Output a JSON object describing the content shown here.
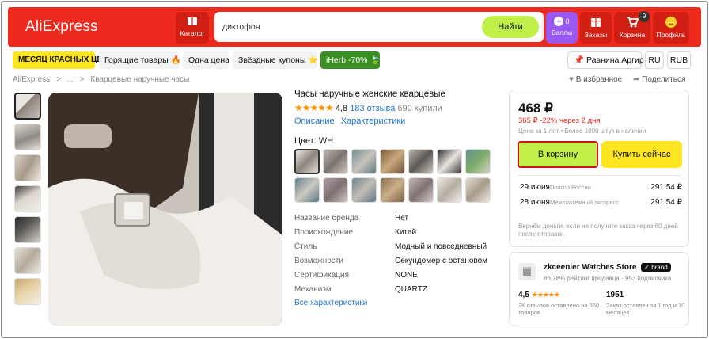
{
  "header": {
    "logo": "AliExpress",
    "catalog_label": "Каталог",
    "search_value": "диктофон",
    "search_button": "Найти",
    "points_label": "Баллы",
    "points_value": "0",
    "orders_label": "Заказы",
    "cart_label": "Корзина",
    "cart_count": "9",
    "profile_label": "Профиль"
  },
  "promo": {
    "red_prices": "МЕСЯЦ КРАСНЫХ ЦЕН",
    "hot": "Горящие товары 🔥",
    "one_price": "Одна цена",
    "star_coupons": "Звёздные купоны ⭐",
    "iherb": "iHerb -70%",
    "location": "Равнина Аргир",
    "lang": "RU",
    "currency": "RUB"
  },
  "breadcrumb": {
    "root": "AliExpress",
    "sep": ">",
    "ellipsis": "...",
    "current": "Кварцевые наручные часы",
    "favorite": "В избранное",
    "share": "Поделиться"
  },
  "product": {
    "title": "Часы наручные женские кварцевые",
    "stars": "★★★★★",
    "rating": "4,8",
    "reviews": "183 отзыва",
    "sold": "690 купили",
    "tab_description": "Описание",
    "tab_specs": "Характеристики",
    "color_label": "Цвет: WH",
    "specs": [
      {
        "k": "Название бренда",
        "v": "Нет"
      },
      {
        "k": "Происхождение",
        "v": "Китай"
      },
      {
        "k": "Стиль",
        "v": "Модный и повседневный"
      },
      {
        "k": "Возможности",
        "v": "Секундомер с остановом"
      },
      {
        "k": "Сертификация",
        "v": "NONE"
      },
      {
        "k": "Механизм",
        "v": "QUARTZ"
      }
    ],
    "all_specs": "Все характеристики"
  },
  "buybox": {
    "price": "468 ₽",
    "old_price": "365 ₽",
    "discount": "-22%",
    "discount_period": "через 2 дня",
    "unit_note": "Цена за 1 лот • Более 1000 штук в наличии",
    "cart_button": "В корзину",
    "buy_button": "Купить сейчас",
    "shipping": [
      {
        "date": "29 июня",
        "service": "Почтой России",
        "price": "291,54 ₽"
      },
      {
        "date": "28 июня",
        "service": "Межплатежный экспресс",
        "price": "291,54 ₽"
      }
    ],
    "refund_note": "Вернём деньги, если не получите заказ через 60 дней после отправки."
  },
  "store": {
    "name": "zkceenier Watches Store",
    "brand_tag": "brand",
    "sub": "86,78% рейтинг продавца · 953 подписчика",
    "rating": "4,5",
    "rating_stars": "★★★★★",
    "rating_sub": "2К отзывов оставлено на 560 товаров",
    "orders": "1951",
    "orders_sub": "Заказ оставлен за 1 год и 10 месяцев"
  },
  "colors": {
    "header_red": "#ed2a1d",
    "accent_green": "#c0f048",
    "accent_yellow": "#ffe620",
    "points_purple": "#9a58f3",
    "link_blue": "#2277cc"
  }
}
